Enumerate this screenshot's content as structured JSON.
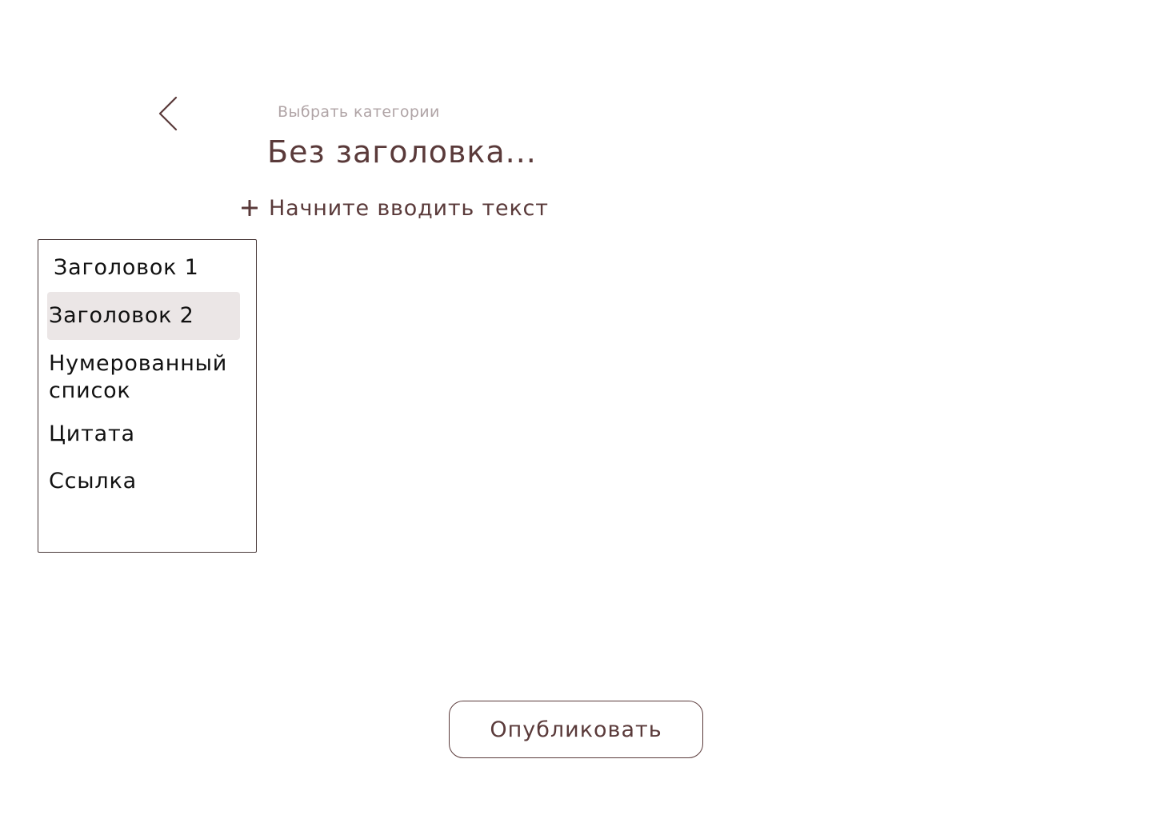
{
  "header": {
    "back_icon": "chevron-left-icon",
    "category_link": "Выбрать категории"
  },
  "editor": {
    "title_placeholder": "Без заголовка...",
    "add_block_icon": "plus-icon",
    "body_placeholder": "Начните вводить текст"
  },
  "block_menu": {
    "items": [
      {
        "label": "Заголовок 1",
        "selected": false
      },
      {
        "label": "Заголовок 2",
        "selected": true
      },
      {
        "label": "Нумерованный список",
        "selected": false
      },
      {
        "label": "Цитата",
        "selected": false
      },
      {
        "label": "Ссылка",
        "selected": false
      }
    ]
  },
  "footer": {
    "publish_label": "Опубликовать"
  },
  "colors": {
    "accent": "#5a3a3a",
    "muted": "#b0a4a6",
    "selected_bg": "#ebe6e6"
  }
}
